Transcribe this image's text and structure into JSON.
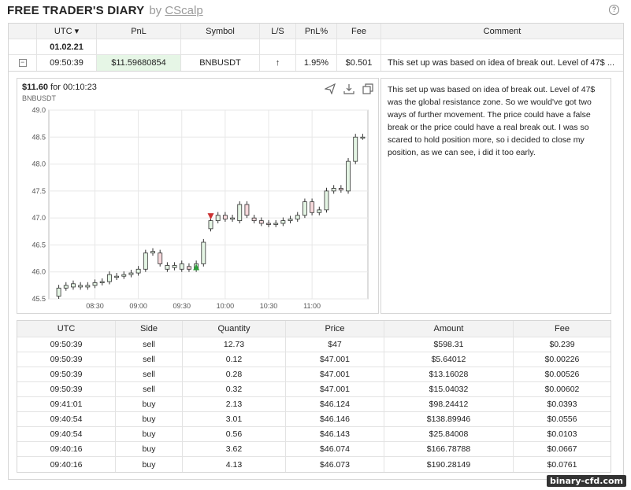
{
  "header": {
    "title": "FREE TRADER'S DIARY",
    "by": "by",
    "brand": "CScalp",
    "help": "?"
  },
  "colors": {
    "bull": "#e4f5e4",
    "bear": "#f7d9dc",
    "green_mark": "#2e9d3a",
    "red_mark": "#cc3333",
    "pnl_bg": "#e6f6e6"
  },
  "main_table": {
    "headers": [
      "",
      "UTC ▾",
      "PnL",
      "Symbol",
      "L/S",
      "PnL%",
      "Fee",
      "Comment"
    ],
    "date_row": "01.02.21",
    "trade": {
      "toggle": "−",
      "utc": "09:50:39",
      "pnl": "$11.59680854",
      "symbol": "BNBUSDT",
      "ls": "↑",
      "pnl_pct": "1.95%",
      "fee": "$0.501",
      "comment_short": "This set up was based on idea of break out. Level of 47$ ..."
    }
  },
  "chart": {
    "title_value": "$11.60",
    "title_for": "for 00:10:23",
    "symbol": "BNBUSDT",
    "icons": [
      "share-icon",
      "download-icon",
      "copy-icon"
    ]
  },
  "comment_full": "This set up was based on idea of break out. Level of 47$ was the global resistance zone. So we would've got two ways of further movement. The price could have a false break or the price could have a real break out. I was so scared to hold position more, so i decided to close my position, as we can see, i did it too early.",
  "chart_data": {
    "type": "candlestick",
    "symbol": "BNBUSDT",
    "ylim": [
      45.5,
      49.0
    ],
    "y_ticks": [
      45.5,
      46.0,
      46.5,
      47.0,
      47.5,
      48.0,
      48.5,
      49.0
    ],
    "x_ticks": [
      "08:30",
      "09:00",
      "09:30",
      "10:00",
      "10:30",
      "11:00"
    ],
    "candles": [
      [
        45.55,
        45.7
      ],
      [
        45.7,
        45.75
      ],
      [
        45.72,
        45.78
      ],
      [
        45.72,
        45.75
      ],
      [
        45.72,
        45.75
      ],
      [
        45.75,
        45.8
      ],
      [
        45.8,
        45.82
      ],
      [
        45.82,
        45.95
      ],
      [
        45.9,
        45.92
      ],
      [
        45.92,
        45.95
      ],
      [
        45.95,
        45.98
      ],
      [
        45.98,
        46.05
      ],
      [
        46.05,
        46.35
      ],
      [
        46.35,
        46.38
      ],
      [
        46.35,
        46.15
      ],
      [
        46.05,
        46.12
      ],
      [
        46.08,
        46.12
      ],
      [
        46.05,
        46.15
      ],
      [
        46.1,
        46.05
      ],
      [
        46.05,
        46.15
      ],
      [
        46.15,
        46.55
      ],
      [
        46.8,
        46.95
      ],
      [
        46.95,
        47.05
      ],
      [
        47.05,
        46.98
      ],
      [
        46.98,
        47.0
      ],
      [
        46.95,
        47.25
      ],
      [
        47.25,
        47.05
      ],
      [
        47.0,
        46.95
      ],
      [
        46.95,
        46.9
      ],
      [
        46.9,
        46.88
      ],
      [
        46.88,
        46.9
      ],
      [
        46.9,
        46.95
      ],
      [
        46.95,
        46.98
      ],
      [
        46.98,
        47.05
      ],
      [
        47.05,
        47.3
      ],
      [
        47.3,
        47.1
      ],
      [
        47.1,
        47.15
      ],
      [
        47.15,
        47.5
      ],
      [
        47.5,
        47.55
      ],
      [
        47.55,
        47.52
      ],
      [
        47.5,
        48.05
      ],
      [
        48.05,
        48.5
      ],
      [
        48.5,
        48.5
      ]
    ],
    "markers": [
      {
        "type": "sell",
        "candle": 21,
        "price": 47.0
      },
      {
        "type": "buy",
        "candle": 19,
        "price": 46.12
      }
    ]
  },
  "fills": {
    "headers": [
      "UTC",
      "Side",
      "Quantity",
      "Price",
      "Amount",
      "Fee"
    ],
    "rows": [
      [
        "09:50:39",
        "sell",
        "12.73",
        "$47",
        "$598.31",
        "$0.239"
      ],
      [
        "09:50:39",
        "sell",
        "0.12",
        "$47.001",
        "$5.64012",
        "$0.00226"
      ],
      [
        "09:50:39",
        "sell",
        "0.28",
        "$47.001",
        "$13.16028",
        "$0.00526"
      ],
      [
        "09:50:39",
        "sell",
        "0.32",
        "$47.001",
        "$15.04032",
        "$0.00602"
      ],
      [
        "09:41:01",
        "buy",
        "2.13",
        "$46.124",
        "$98.24412",
        "$0.0393"
      ],
      [
        "09:40:54",
        "buy",
        "3.01",
        "$46.146",
        "$138.89946",
        "$0.0556"
      ],
      [
        "09:40:54",
        "buy",
        "0.56",
        "$46.143",
        "$25.84008",
        "$0.0103"
      ],
      [
        "09:40:16",
        "buy",
        "3.62",
        "$46.074",
        "$166.78788",
        "$0.0667"
      ],
      [
        "09:40:16",
        "buy",
        "4.13",
        "$46.073",
        "$190.28149",
        "$0.0761"
      ]
    ]
  },
  "watermark": "binary-cfd.com"
}
